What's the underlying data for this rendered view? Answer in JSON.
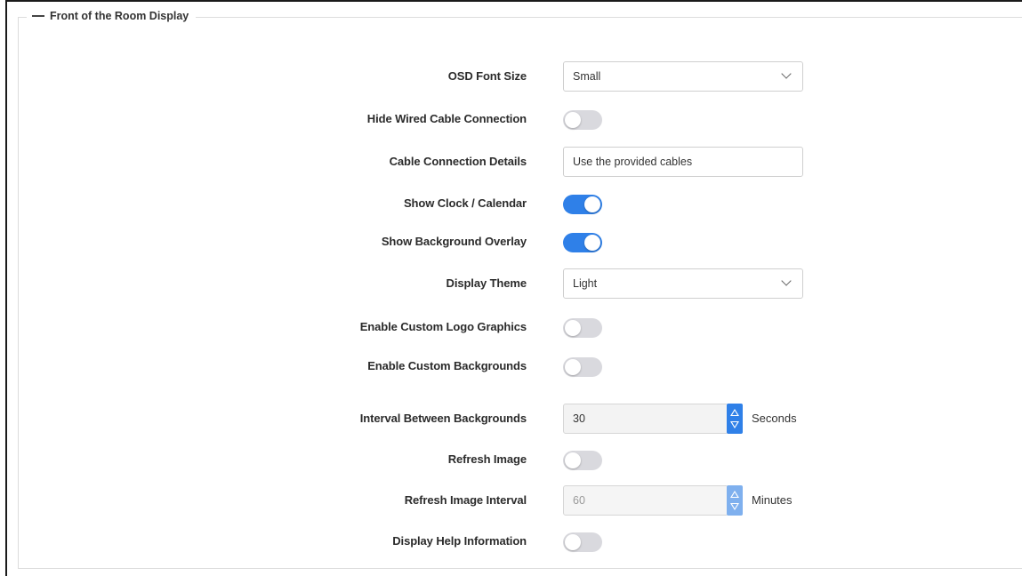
{
  "section": {
    "title": "Front of the Room Display"
  },
  "fields": {
    "osd_font_size": {
      "label": "OSD Font Size",
      "value": "Small"
    },
    "hide_wired_cable": {
      "label": "Hide Wired Cable Connection",
      "on": false
    },
    "cable_details": {
      "label": "Cable Connection Details",
      "value": "Use the provided cables"
    },
    "show_clock": {
      "label": "Show Clock / Calendar",
      "on": true
    },
    "show_bg_overlay": {
      "label": "Show Background Overlay",
      "on": true
    },
    "display_theme": {
      "label": "Display Theme",
      "value": "Light"
    },
    "custom_logo": {
      "label": "Enable Custom Logo Graphics",
      "on": false
    },
    "custom_bg": {
      "label": "Enable Custom Backgrounds",
      "on": false
    },
    "bg_interval": {
      "label": "Interval Between Backgrounds",
      "value": "30",
      "unit": "Seconds"
    },
    "refresh_image": {
      "label": "Refresh Image",
      "on": false
    },
    "refresh_interval": {
      "label": "Refresh Image Interval",
      "value": "60",
      "unit": "Minutes",
      "disabled": true
    },
    "help_info": {
      "label": "Display Help Information",
      "on": false
    }
  },
  "colors": {
    "accent": "#2f80e8",
    "toggle_off": "#d9d9de"
  }
}
